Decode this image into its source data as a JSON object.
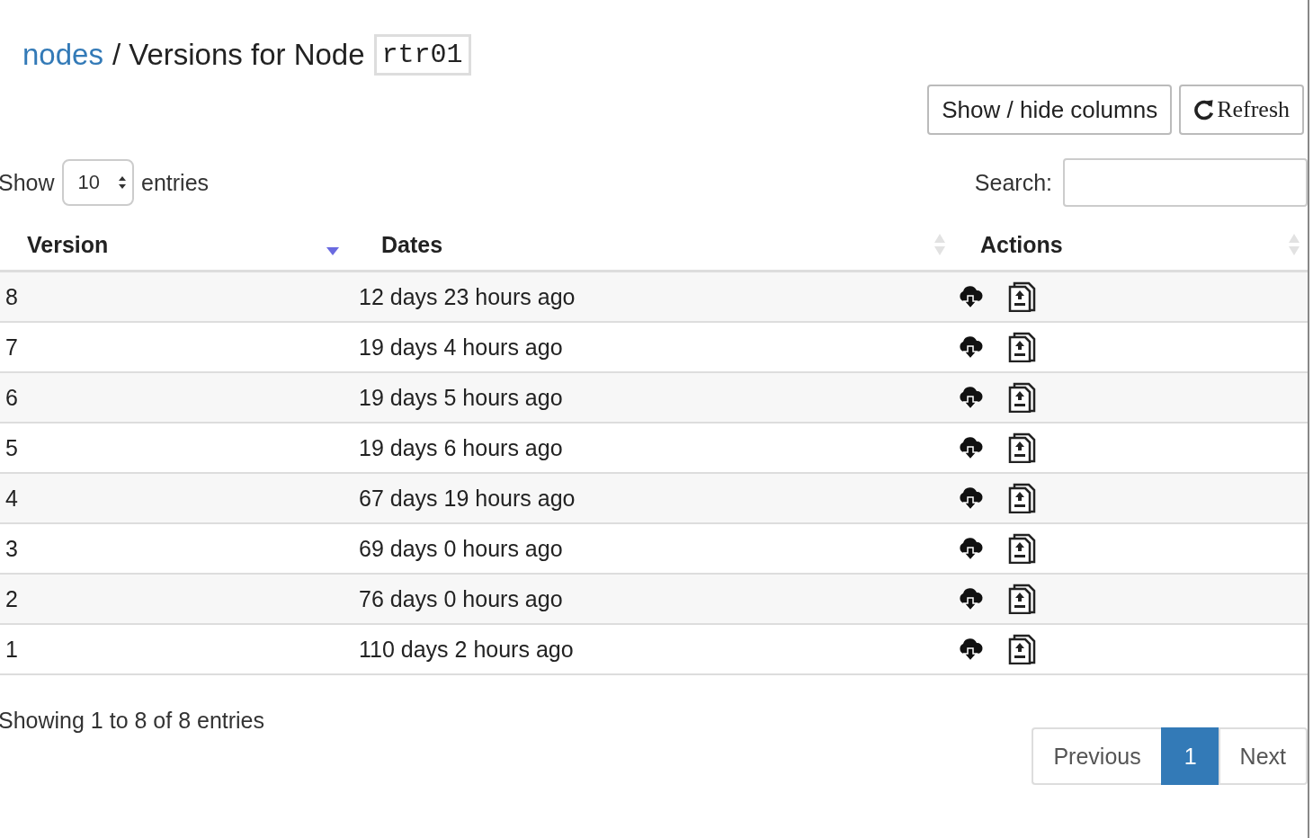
{
  "breadcrumb": {
    "link": "nodes",
    "separator": "/",
    "title": "Versions for Node",
    "node": "rtr01"
  },
  "toolbar": {
    "buttons": [
      {
        "label": "Show / hide columns",
        "kind": "text"
      },
      {
        "label": "Refresh",
        "kind": "refresh"
      }
    ]
  },
  "length_menu": {
    "before": "Show",
    "value": "10",
    "after": "entries"
  },
  "search": {
    "label": "Search:"
  },
  "table": {
    "columns": [
      {
        "label": "Version",
        "sorted": true
      },
      {
        "label": "Dates",
        "sorted": false
      },
      {
        "label": "Actions",
        "sorted": false
      }
    ],
    "rows": [
      {
        "version": "8",
        "date": "12 days 23 hours ago"
      },
      {
        "version": "7",
        "date": "19 days 4 hours ago"
      },
      {
        "version": "6",
        "date": "19 days 5 hours ago"
      },
      {
        "version": "5",
        "date": "19 days 6 hours ago"
      },
      {
        "version": "4",
        "date": "67 days 19 hours ago"
      },
      {
        "version": "3",
        "date": "69 days 0 hours ago"
      },
      {
        "version": "2",
        "date": "76 days 0 hours ago"
      },
      {
        "version": "1",
        "date": "110 days 2 hours ago"
      }
    ]
  },
  "info": "Showing 1 to 8 of 8 entries",
  "pagination": {
    "previous": "Previous",
    "pages": [
      {
        "label": "1",
        "selected": true
      }
    ],
    "next": "Next"
  }
}
